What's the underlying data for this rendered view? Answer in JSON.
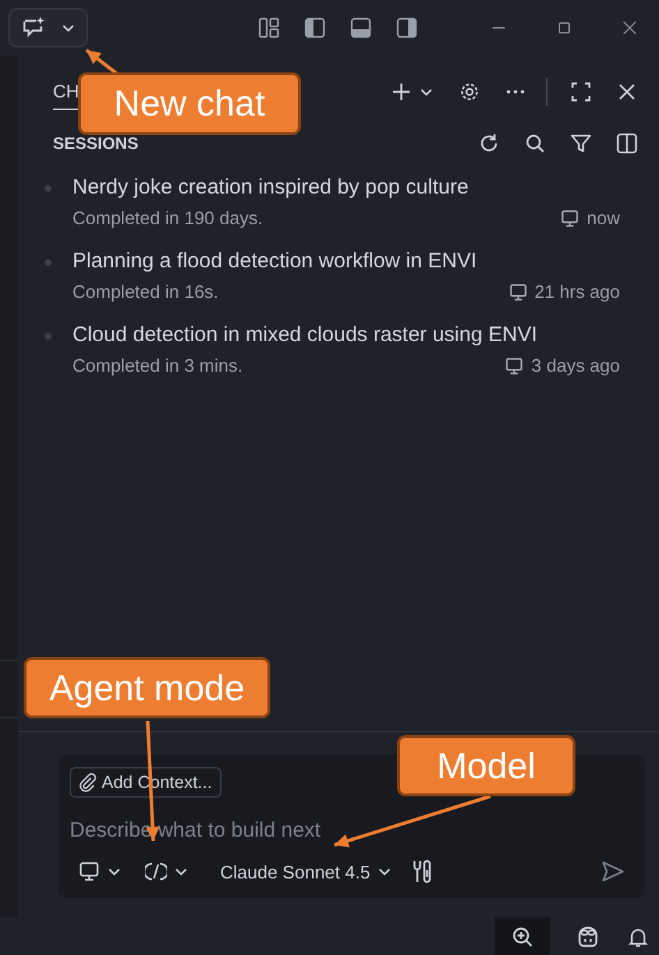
{
  "chat_panel": {
    "tabs": [
      {
        "label": "CH",
        "selected": true
      }
    ],
    "sessions_heading": "SESSIONS",
    "sessions": [
      {
        "title": "Nerdy joke creation inspired by pop culture",
        "status": "Completed in 190 days.",
        "time": "now"
      },
      {
        "title": "Planning a flood detection workflow in ENVI",
        "status": "Completed in 16s.",
        "time": "21 hrs ago"
      },
      {
        "title": "Cloud detection in mixed clouds raster using ENVI",
        "status": "Completed in 3 mins.",
        "time": "3 days ago"
      }
    ],
    "input": {
      "add_context": "Add Context...",
      "placeholder": "Describe what to build next",
      "model": "Claude Sonnet 4.5"
    }
  },
  "callouts": [
    {
      "text": "New chat"
    },
    {
      "text": "Agent mode"
    },
    {
      "text": "Model"
    }
  ]
}
